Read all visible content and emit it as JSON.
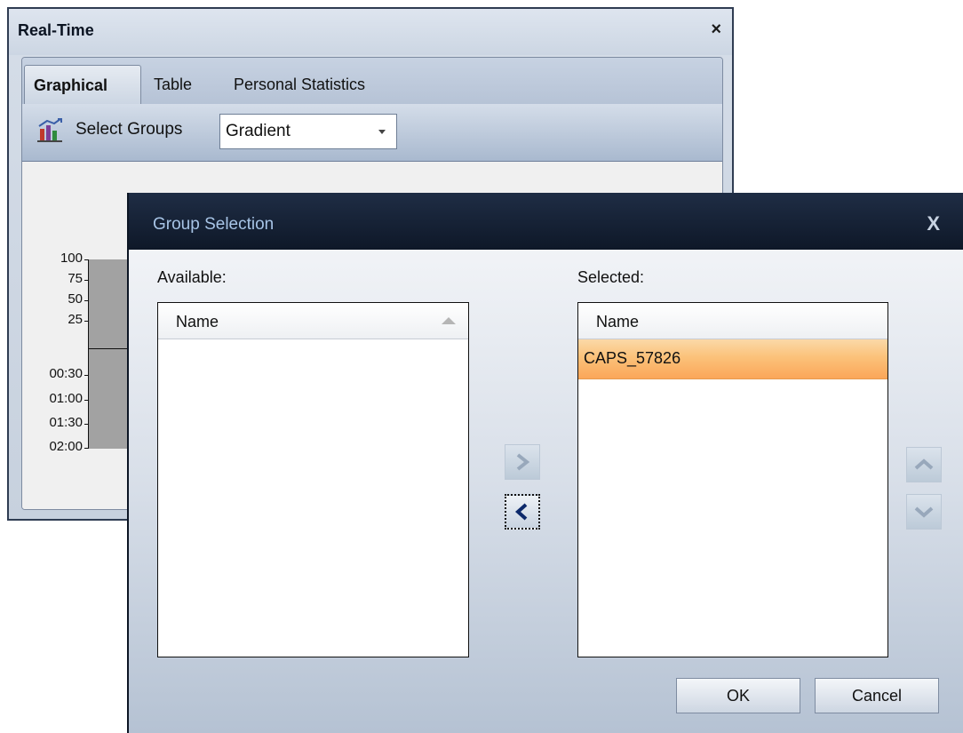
{
  "realtime_window": {
    "title": "Real-Time",
    "close_glyph": "×",
    "tabs": [
      {
        "label": "Graphical",
        "active": true
      },
      {
        "label": "Table",
        "active": false
      },
      {
        "label": "Personal Statistics",
        "active": false
      }
    ],
    "toolbar": {
      "select_groups_label": "Select Groups",
      "select_groups_icon": "bar-chart-icon",
      "display_mode": {
        "value": "Gradient"
      }
    },
    "chart_ticks": [
      "100",
      "75",
      "50",
      "25",
      "00:30",
      "01:00",
      "01:30",
      "02:00"
    ]
  },
  "dialog": {
    "title": "Group Selection",
    "close_glyph": "X",
    "available": {
      "label": "Available:",
      "column_header": "Name",
      "items": []
    },
    "selected": {
      "label": "Selected:",
      "column_header": "Name",
      "items": [
        "CAPS_57826"
      ]
    },
    "transfer_buttons": {
      "move_right": {
        "glyph": ">",
        "enabled": false
      },
      "move_left": {
        "glyph": "<",
        "enabled": true
      }
    },
    "order_buttons": {
      "move_up": {
        "icon": "chevron-up-icon",
        "enabled": false
      },
      "move_down": {
        "icon": "chevron-down-icon",
        "enabled": false
      }
    },
    "ok_label": "OK",
    "cancel_label": "Cancel"
  },
  "colors": {
    "dialog_title_bar": "#14213a",
    "dialog_title_text": "#a7c4e6",
    "selected_row": "#fbc27a",
    "chart_bar": "#a2a2a2"
  }
}
